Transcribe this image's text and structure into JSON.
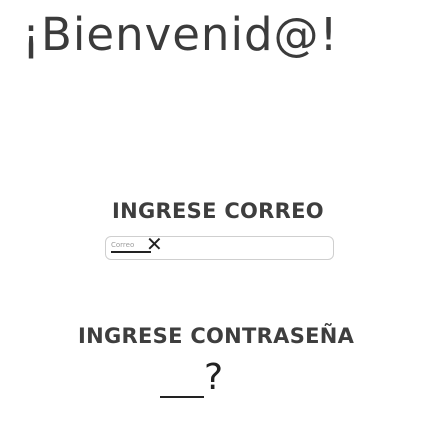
{
  "header": {
    "title": "¡Bienvenid@!"
  },
  "email_section": {
    "label": "INGRESE CORREO",
    "placeholder": "Correo",
    "annotation": "✕"
  },
  "password_section": {
    "label": "INGRESE CONTRASEÑA",
    "annotation": "?"
  }
}
